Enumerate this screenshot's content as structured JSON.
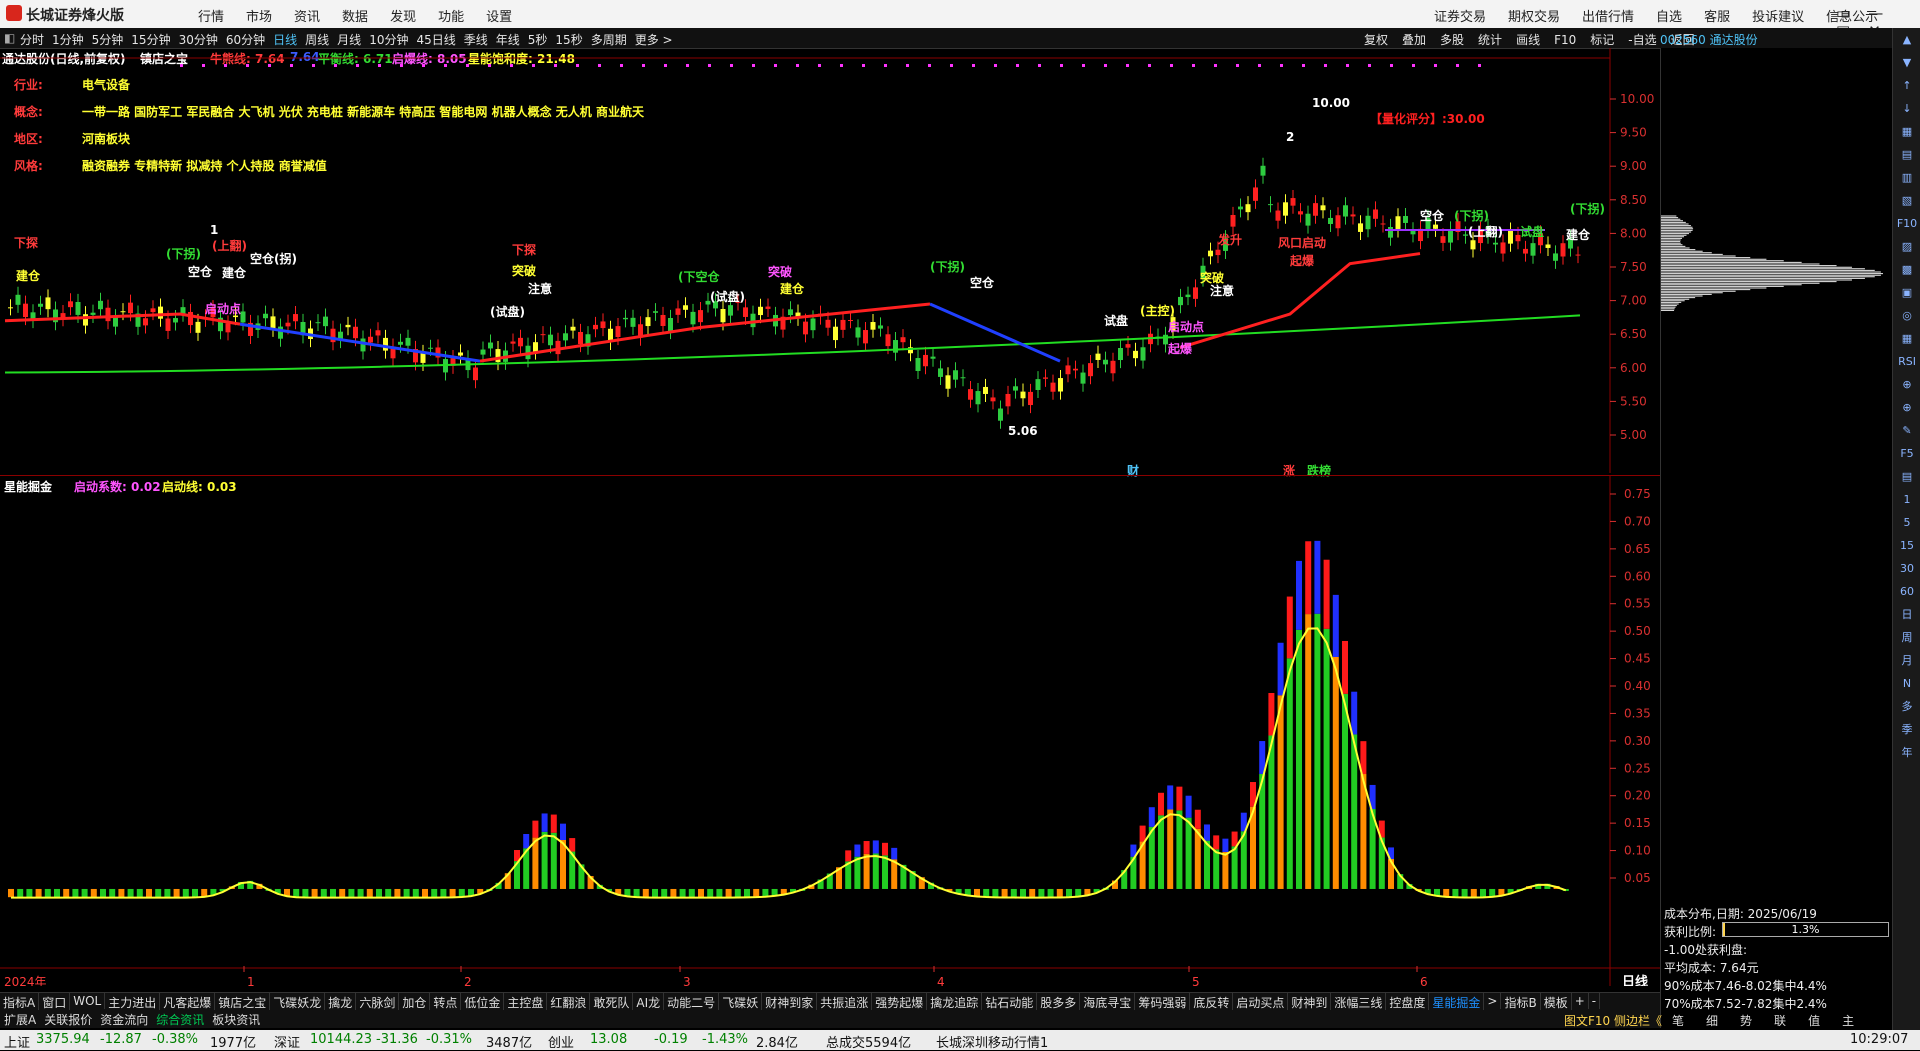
{
  "titlebar": {
    "app_name": "长城证券烽火版",
    "main_menu": [
      "行情",
      "市场",
      "资讯",
      "数据",
      "发现",
      "功能",
      "设置"
    ],
    "right_menu": [
      "证券交易",
      "期权交易",
      "出借行情",
      "自选",
      "客服",
      "投诉建议",
      "信息公示"
    ],
    "window_controls": [
      "▭",
      "—",
      "□",
      "✕"
    ]
  },
  "toolbar": {
    "periods": [
      "分时",
      "1分钟",
      "5分钟",
      "15分钟",
      "30分钟",
      "60分钟",
      "日线",
      "周线",
      "月线",
      "10分钟",
      "45日线",
      "季线",
      "年线",
      "5秒",
      "15秒",
      "多周期",
      "更多 >"
    ],
    "active_period": "日线",
    "tools": [
      "复权",
      "叠加",
      "多股",
      "统计",
      "画线",
      "F10",
      "标记",
      "-自选",
      "返回"
    ],
    "stock_code": "002560",
    "stock_name": "通达股份"
  },
  "kline": {
    "stock_title": "通达股份(日线,前复权)",
    "indicator": "镇店之宝",
    "niu_label": "牛熊线: 7.64",
    "niu_extra": "7.64",
    "ping_label": "平衡线: 6.71",
    "qibao_label": "启爆线: 8.05",
    "xingneng_label": "星能饱和度: 21.48",
    "info": [
      {
        "k": "行业:",
        "v": "电气设备"
      },
      {
        "k": "概念:",
        "v": "一带一路 国防军工 军民融合 大飞机 光伏 充电桩 新能源车 特高压 智能电网 机器人概念 无人机 商业航天"
      },
      {
        "k": "地区:",
        "v": "河南板块"
      },
      {
        "k": "风格:",
        "v": "融资融券 专精特新 拟减持 个人持股 商誉减值"
      }
    ],
    "score": "【量化评分】:30.00",
    "high_mark": "10.00",
    "low_mark": "5.06",
    "badges": {
      "cai": "财",
      "zhang": "涨",
      "dieting": "跌榜"
    },
    "y_ticks": [
      "10.00",
      "9.50",
      "9.00",
      "8.50",
      "8.00",
      "7.50",
      "7.00",
      "6.50",
      "6.00",
      "5.50",
      "5.00"
    ],
    "annotations": [
      "下探",
      "建仓",
      "(下拐)",
      "空仓",
      "1",
      "(上翻)",
      "建仓",
      "空仓(拐)",
      "启动点",
      "(试盘)",
      "下探",
      "突破",
      "注意",
      "(下空仓",
      "(试盘)",
      "突破",
      "建仓",
      "(下拐)",
      "空仓",
      "试盘",
      "(主控)",
      "启动点",
      "起爆",
      "突破",
      "注意",
      "发升",
      "2",
      "风口启动",
      "起爆",
      "空仓",
      "(下拐)",
      "(上翻)",
      "试盘",
      "(下拐)",
      "建仓"
    ]
  },
  "indicator_panel": {
    "name": "星能掘金",
    "qidong_xishu": "启动系数: 0.02",
    "qidong_xian": "启动线: 0.03",
    "y_ticks": [
      "0.75",
      "0.70",
      "0.65",
      "0.60",
      "0.55",
      "0.50",
      "0.45",
      "0.40",
      "0.35",
      "0.30",
      "0.25",
      "0.20",
      "0.15",
      "0.10",
      "0.05"
    ],
    "x_labels": [
      "2024年",
      "1",
      "2",
      "3",
      "4",
      "5",
      "6"
    ],
    "period_label": "日线"
  },
  "tabs_row1": [
    "指标A",
    "窗口",
    "WOL",
    "主力进出",
    "凡客起爆",
    "镇店之宝",
    "飞碟妖龙",
    "擒龙",
    "六脉剑",
    "加仓",
    "转点",
    "低位金",
    "主控盘",
    "红翻浪",
    "敢死队",
    "AI龙",
    "动能二号",
    "飞碟妖",
    "财神到家",
    "共振追涨",
    "强势起爆",
    "擒龙追踪",
    "钻石动能",
    "股多多",
    "海底寻宝",
    "筹码强弱",
    "底反转",
    "启动买点",
    "财神到",
    "涨幅三线",
    "控盘度",
    "星能掘金",
    ">",
    "指标B",
    "模板",
    "+",
    "-"
  ],
  "tabs_row1_active": "星能掘金",
  "tabs_row2": [
    "扩展A",
    "关联报价",
    "资金流向",
    "综合资讯",
    "板块资讯"
  ],
  "tabs_row2_active": "综合资讯",
  "right_panel": {
    "cost_title": "成本分布,日期: 2025/06/19",
    "ratio_label": "获利比例:",
    "ratio_value": "1.3%",
    "profit_line": "-1.00处获利盘:",
    "avg_cost": "平均成本: 7.64元",
    "c90": "90%成本7.46-8.02集中4.4%",
    "c70": "70%成本7.52-7.82集中2.4%",
    "f10_link": "图文F10",
    "side_link": "侧边栏《",
    "bottom_tabs": [
      "笔",
      "细",
      "势",
      "联",
      "值",
      "主",
      "筹"
    ]
  },
  "sidebar_items": [
    "▲",
    "▼",
    "↑",
    "↓",
    "▦",
    "▤",
    "▥",
    "▧",
    "F10",
    "▨",
    "▩",
    "▣",
    "◎",
    "▦",
    "RSI",
    "⊕",
    "⊕",
    "✎",
    "F5",
    "▤",
    "1",
    "5",
    "15",
    "30",
    "60",
    "日",
    "周",
    "月",
    "N",
    "多",
    "季",
    "年"
  ],
  "status": {
    "sh_name": "上证",
    "sh_val": "3375.94",
    "sh_chg": "-12.87",
    "sh_pct": "-0.38%",
    "sh_amt": "1977亿",
    "sz_name": "深证",
    "sz_val": "10144.23",
    "sz_chg": "-31.36",
    "sz_pct": "-0.31%",
    "sz_amt": "3487亿",
    "cy_name": "创业",
    "cy_val": "13.08",
    "cy_chg": "-0.19",
    "cy_pct": "-1.43%",
    "cy_amt": "2.84亿",
    "total": "总成交5594亿",
    "server": "长城深圳移动行情1",
    "time": "10:29:07"
  }
}
